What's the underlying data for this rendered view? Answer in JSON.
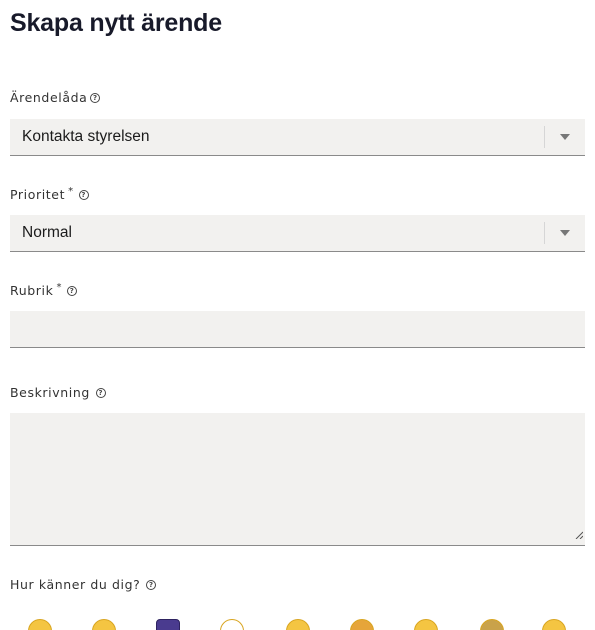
{
  "page": {
    "title": "Skapa nytt ärende"
  },
  "form": {
    "mailbox": {
      "label": "Ärendelåda",
      "value": "Kontakta styrelsen",
      "help_icon": "question-circle-icon"
    },
    "priority": {
      "label": "Prioritet",
      "required_mark": "*",
      "value": "Normal",
      "help_icon": "question-circle-icon"
    },
    "subject": {
      "label": "Rubrik",
      "required_mark": "*",
      "value": "",
      "help_icon": "question-circle-icon"
    },
    "description": {
      "label": "Beskrivning",
      "value": "",
      "help_icon": "question-circle-icon"
    },
    "mood": {
      "label": "Hur känner du dig?",
      "help_icon": "question-circle-icon",
      "options": [
        {
          "icon": "smiling-face-icon"
        },
        {
          "icon": "grinning-face-icon"
        },
        {
          "icon": "face-with-hat-icon"
        },
        {
          "icon": "rolling-eyes-face-icon"
        },
        {
          "icon": "sweating-face-icon"
        },
        {
          "icon": "sad-face-icon"
        },
        {
          "icon": "crying-face-icon"
        },
        {
          "icon": "glasses-face-icon"
        },
        {
          "icon": "winking-face-icon"
        }
      ]
    }
  },
  "colors": {
    "field_bg": "#f2f1ef",
    "title": "#181a2a"
  }
}
